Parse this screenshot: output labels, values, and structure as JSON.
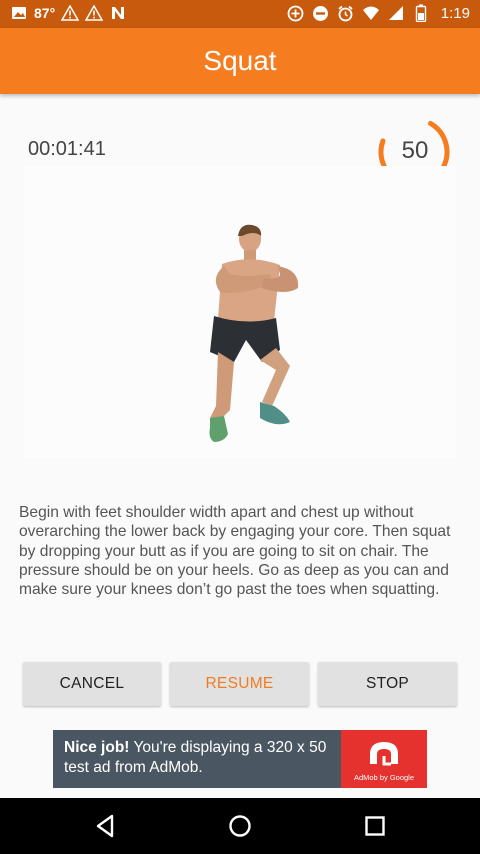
{
  "status_bar": {
    "temperature": "87°",
    "time": "1:19",
    "icons": [
      "image-icon",
      "warning-icon",
      "warning-icon",
      "n-icon",
      "sync-icon",
      "do-not-disturb-icon",
      "alarm-icon",
      "wifi-icon",
      "signal-icon",
      "battery-icon"
    ]
  },
  "app_bar": {
    "title": "Squat"
  },
  "workout": {
    "elapsed": "00:01:41",
    "countdown": "50",
    "countdown_fraction": 0.72,
    "ring_color": "#f57c1f"
  },
  "description": "Begin with feet shoulder width apart and chest up without overarching the lower back by engaging your core. Then squat by dropping your butt as if you are going to sit on chair. The pressure should be on your heels. Go as deep as you can and make sure your knees don’t go past the toes when squatting.",
  "buttons": {
    "cancel": "CANCEL",
    "resume": "RESUME",
    "stop": "STOP"
  },
  "ad": {
    "headline": "Nice job!",
    "body": " You're displaying a 320 x 50 test ad from AdMob.",
    "logo_caption": "AdMob by Google"
  },
  "nav_bar": {
    "icons": [
      "back-icon",
      "home-icon",
      "recents-icon"
    ]
  },
  "colors": {
    "accent": "#f57c1f",
    "status_bar": "#c85a0e"
  }
}
